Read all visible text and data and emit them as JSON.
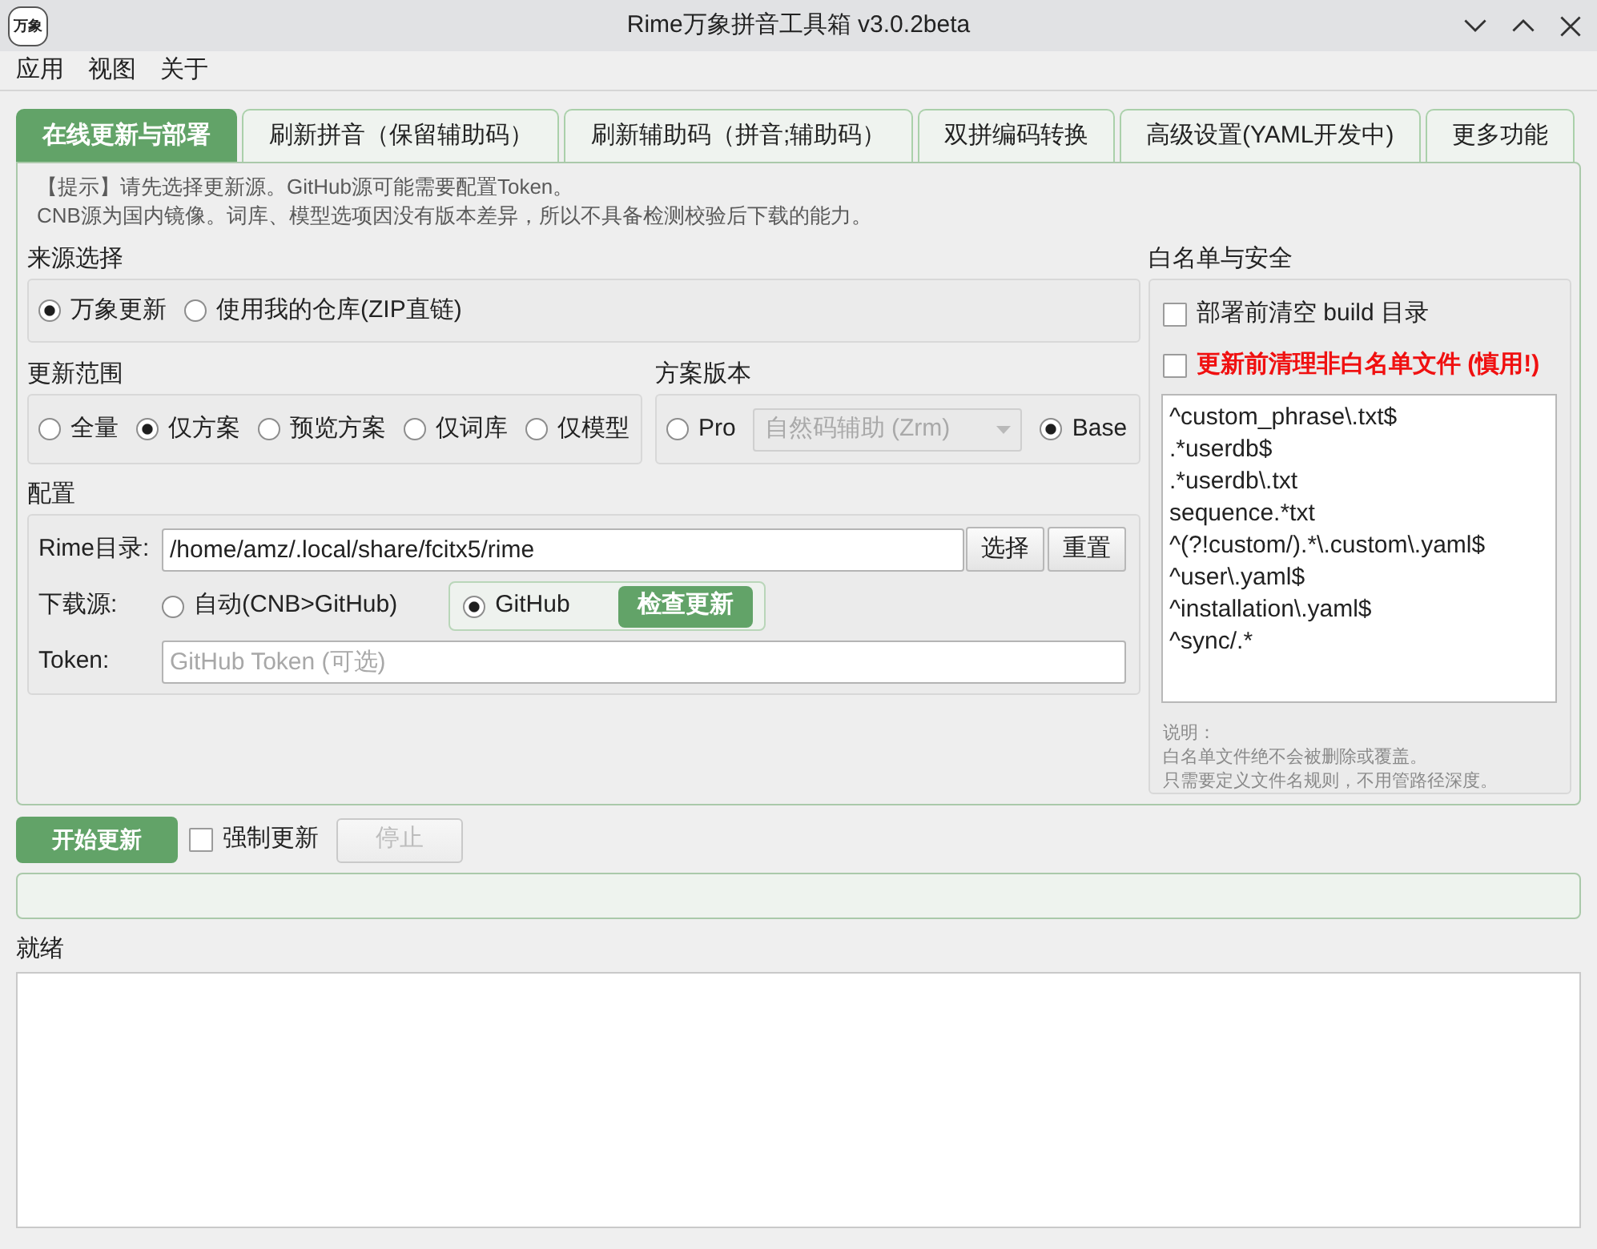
{
  "window": {
    "title": "Rime万象拼音工具箱 v3.0.2beta",
    "app_icon_text": "万象"
  },
  "menu": [
    "应用",
    "视图",
    "关于"
  ],
  "tabs": [
    {
      "label": "在线更新与部署",
      "selected": true
    },
    {
      "label": "刷新拼音（保留辅助码）",
      "selected": false
    },
    {
      "label": "刷新辅助码（拼音;辅助码）",
      "selected": false
    },
    {
      "label": "双拼编码转换",
      "selected": false
    },
    {
      "label": "高级设置(YAML开发中)",
      "selected": false
    },
    {
      "label": "更多功能",
      "selected": false
    }
  ],
  "hint": [
    "【提示】请先选择更新源。GitHub源可能需要配置Token。",
    "CNB源为国内镜像。词库、模型选项因没有版本差异，所以不具备检测校验后下载的能力。"
  ],
  "source": {
    "title": "来源选择",
    "options": [
      {
        "label": "万象更新",
        "selected": true
      },
      {
        "label": "使用我的仓库(ZIP直链)",
        "selected": false
      }
    ]
  },
  "scope": {
    "title": "更新范围",
    "options": [
      {
        "label": "全量",
        "selected": false
      },
      {
        "label": "仅方案",
        "selected": true
      },
      {
        "label": "预览方案",
        "selected": false
      },
      {
        "label": "仅词库",
        "selected": false
      },
      {
        "label": "仅模型",
        "selected": false
      }
    ]
  },
  "scheme_version": {
    "title": "方案版本",
    "options": [
      {
        "label": "Pro",
        "selected": false,
        "dropdown": {
          "value": "自然码辅助 (Zrm)",
          "disabled": true
        }
      },
      {
        "label": "Base",
        "selected": true
      }
    ]
  },
  "config": {
    "title": "配置",
    "rime_dir": {
      "label": "Rime目录:",
      "value": "/home/amz/.local/share/fcitx5/rime",
      "buttons": [
        "选择",
        "重置"
      ]
    },
    "download_source": {
      "label": "下载源:",
      "options": [
        {
          "label": "自动(CNB>GitHub)",
          "selected": false
        },
        {
          "label": "GitHub",
          "selected": true,
          "button": "检查更新"
        }
      ]
    },
    "token": {
      "label": "Token:",
      "placeholder": "GitHub Token (可选)"
    }
  },
  "whitelist": {
    "title": "白名单与安全",
    "options": [
      {
        "label": "部署前清空 build 目录",
        "checked": false,
        "kind": "normal"
      },
      {
        "label": "更新前清理非白名单文件 (慎用!)",
        "checked": false,
        "kind": "warning"
      }
    ],
    "patterns": [
      "^custom_phrase\\.txt$",
      ".*userdb$",
      ".*userdb\\.txt",
      "sequence.*txt",
      "^(?!custom/).*\\.custom\\.yaml$",
      "^user\\.yaml$",
      "^installation\\.yaml$",
      "^sync/.*"
    ],
    "notes": [
      "说明：",
      "白名单文件绝不会被删除或覆盖。",
      "只需要定义文件名规则，不用管路径深度。"
    ]
  },
  "actions": {
    "start_button": "开始更新",
    "force_update": {
      "label": "强制更新",
      "checked": false
    },
    "stop_button": {
      "label": "停止",
      "disabled": true
    }
  },
  "progress": {
    "level": 0
  },
  "status": "就绪"
}
